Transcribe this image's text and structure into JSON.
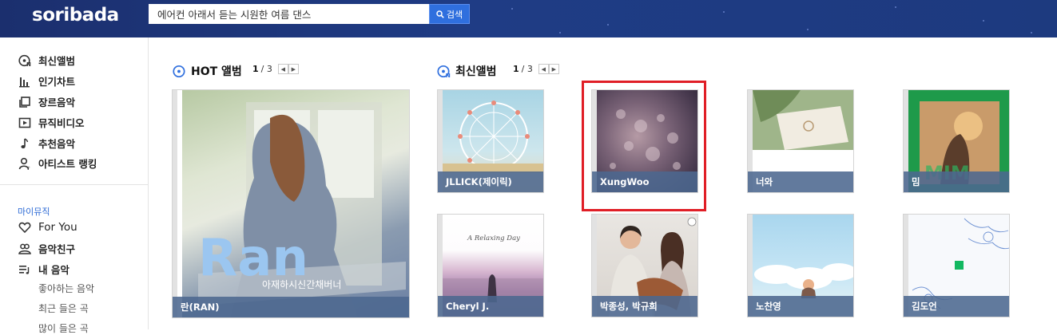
{
  "header": {
    "logo": "soribada",
    "search_value": "에어컨 아래서 듣는 시원한 여름 댄스",
    "search_button": "검색"
  },
  "sidebar": {
    "items": [
      {
        "label": "최신앨범",
        "icon": "new-album-icon"
      },
      {
        "label": "인기차트",
        "icon": "chart-bars-icon"
      },
      {
        "label": "장르음악",
        "icon": "genre-icon"
      },
      {
        "label": "뮤직비디오",
        "icon": "video-play-icon"
      },
      {
        "label": "추천음악",
        "icon": "music-note-icon"
      },
      {
        "label": "아티스트 랭킹",
        "icon": "artist-icon"
      }
    ],
    "section_label": "마이뮤직",
    "my_items": [
      {
        "label": "For You",
        "icon": "heart-icon"
      },
      {
        "label": "음악친구",
        "icon": "friends-icon"
      },
      {
        "label": "내 음악",
        "icon": "playlist-icon"
      }
    ],
    "sub_items": [
      "좋아하는 음악",
      "최근 들은 곡",
      "많이 들은 곡"
    ]
  },
  "hot": {
    "title": "HOT 앨범",
    "page_current": "1",
    "page_total": "/ 3",
    "album": {
      "caption": "란(RAN)",
      "art_text": "Ran",
      "art_subtext": "아재하시신간채버너"
    }
  },
  "new": {
    "title": "최신앨범",
    "page_current": "1",
    "page_total": "/ 3",
    "albums": [
      {
        "caption": "JLLICK(제이릭)"
      },
      {
        "caption": "XungWoo"
      },
      {
        "caption": "너와"
      },
      {
        "caption": "밈"
      },
      {
        "caption": "Cheryl J.",
        "art_text": "A Relaxing Day"
      },
      {
        "caption": "박종성, 박규희"
      },
      {
        "caption": "노찬영"
      },
      {
        "caption": "김도언"
      }
    ]
  },
  "colors": {
    "header": "#1f3c85",
    "accent": "#2f6fde",
    "caption_bg": "#4c688f",
    "highlight": "#e01e26"
  }
}
